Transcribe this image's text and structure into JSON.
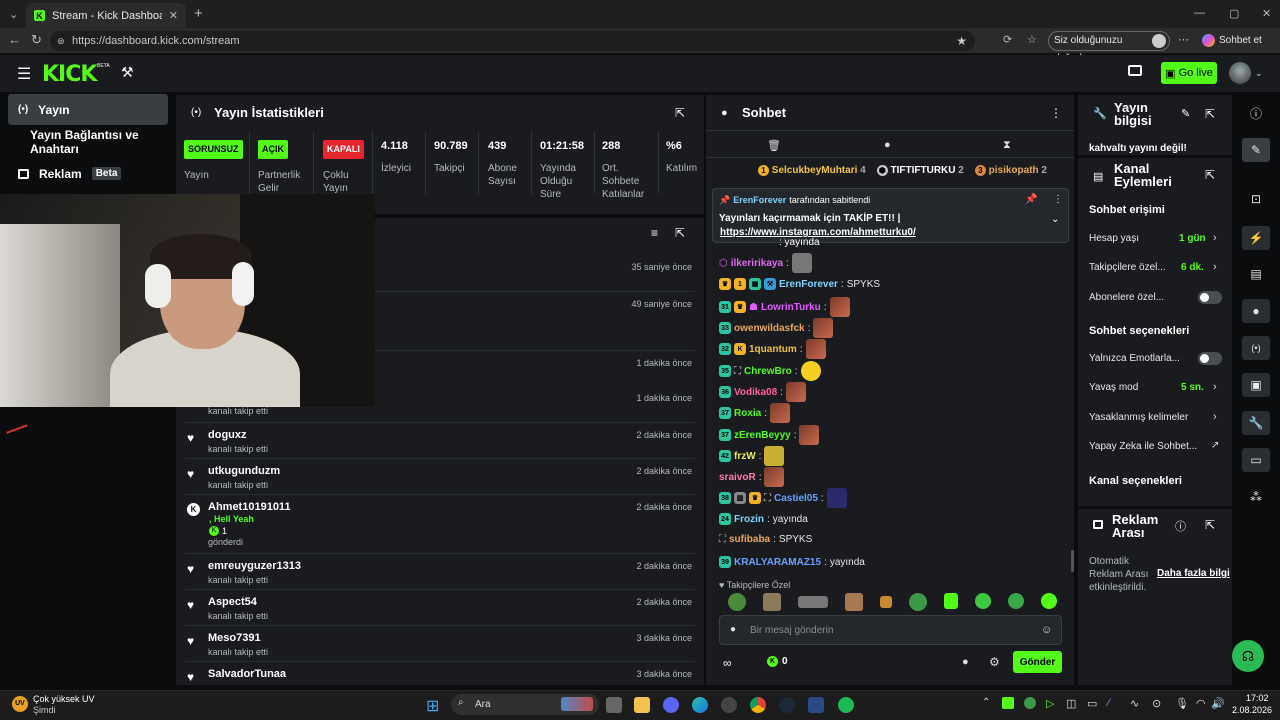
{
  "browser": {
    "tab_title": "Stream - Kick Dashboard",
    "url": "https://dashboard.kick.com/stream",
    "verify_chip": "Siz olduğunuzu doğrulayın",
    "copilot_label": "Sohbet et"
  },
  "topbar": {
    "logo": "KICK",
    "logo_beta": "BETA",
    "go_live": "Go live"
  },
  "leftnav": {
    "items": [
      {
        "label": "Yayın"
      },
      {
        "label": "Yayın Bağlantısı ve Anahtarı"
      },
      {
        "label": "Reklam",
        "badge": "Beta"
      }
    ]
  },
  "stats": {
    "title": "Yayın İstatistikleri",
    "items": [
      {
        "badge": "SORUNSUZ",
        "label": "Yayın",
        "color": "#53fc18"
      },
      {
        "badge": "AÇIK",
        "label": "Partnerlik Gelir",
        "color": "#53fc18"
      },
      {
        "badge": "KAPALI",
        "label": "Çoklu Yayın",
        "color": "#e5262d"
      },
      {
        "value": "4.118",
        "label": "İzleyici"
      },
      {
        "value": "90.789",
        "label": "Takipçi"
      },
      {
        "value": "439",
        "label": "Abone Sayısı"
      },
      {
        "value": "01:21:58",
        "label": "Yayında Olduğu Süre"
      },
      {
        "value": "288",
        "label": "Ort. Sohbete Katılanlar"
      },
      {
        "value": "%6",
        "label": "Katılım"
      }
    ]
  },
  "events": {
    "rows": [
      {
        "name": "",
        "sub": "",
        "time": "35 saniye önce"
      },
      {
        "name": "",
        "sub": "",
        "time": "49 saniye önce"
      },
      {
        "name": "",
        "sub": "",
        "time": "1 dakika önce"
      },
      {
        "name": "",
        "sub": "kanalı takip etti",
        "time": "1 dakika önce"
      },
      {
        "name": "doguxz",
        "sub": "kanalı takip etti",
        "time": "2 dakika önce"
      },
      {
        "name": "utkugunduzm",
        "sub": "kanalı takip etti",
        "time": "2 dakika önce"
      },
      {
        "name": "Ahmet10191011",
        "sub": "gönderdi",
        "message": ", Hell Yeah",
        "amount": "1",
        "time": "2 dakika önce"
      },
      {
        "name": "emreuyguzer1313",
        "sub": "kanalı takip etti",
        "time": "2 dakika önce"
      },
      {
        "name": "Aspect54",
        "sub": "kanalı takip etti",
        "time": "2 dakika önce"
      },
      {
        "name": "Meso7391",
        "sub": "kanalı takip etti",
        "time": "3 dakika önce"
      },
      {
        "name": "SalvadorTunaa",
        "sub": "",
        "time": "3 dakika önce"
      }
    ]
  },
  "chat": {
    "title": "Sohbet",
    "top_gifters": [
      {
        "rank": "1",
        "name": "SelcukbeyMuhtari",
        "count": "4"
      },
      {
        "rank": "",
        "name": "TIFTIFTURKU",
        "count": "2"
      },
      {
        "rank": "3",
        "name": "pisikopath",
        "count": "2"
      }
    ],
    "pinned": {
      "by_user": "ErenForever",
      "by_text": "tarafından sabitlendi",
      "message": "Yayınları kaçırmamak için TAKİP ET!! |",
      "link": "https://www.instagram.com/ahmetturku0/"
    },
    "partial_top": ": yayında",
    "messages": [
      {
        "lvl": "",
        "user": "ilkeririkaya",
        "color": "#e06cf0",
        "text": ""
      },
      {
        "lvl": "",
        "user": "ErenForever",
        "color": "#7fd4ff",
        "text": "SPYKS"
      },
      {
        "lvl": "31",
        "user": "LowrinTurku",
        "color": "#e05cff",
        "text": ""
      },
      {
        "lvl": "33",
        "user": "owenwildasfck",
        "color": "#e8a75a",
        "text": ""
      },
      {
        "lvl": "32",
        "user": "1quantum",
        "color": "#f0c040",
        "text": ""
      },
      {
        "lvl": "35",
        "user": "ChrewBro",
        "color": "#53fc18",
        "text": ""
      },
      {
        "lvl": "36",
        "user": "Vodika08",
        "color": "#ff5fa0",
        "text": ""
      },
      {
        "lvl": "37",
        "user": "Roxia",
        "color": "#53fc18",
        "text": ""
      },
      {
        "lvl": "37",
        "user": "zErenBeyyy",
        "color": "#53fc18",
        "text": ""
      },
      {
        "lvl": "42",
        "user": "frzW",
        "color": "#e8e85a",
        "text": ""
      },
      {
        "lvl": "",
        "user": "sraivoR",
        "color": "#ff7bb0",
        "text": ""
      },
      {
        "lvl": "38",
        "user": "Castiel05",
        "color": "#6aa0ff",
        "text": ""
      },
      {
        "lvl": "24",
        "user": "Frozin",
        "color": "#7fd4ff",
        "text": "yayında"
      },
      {
        "lvl": "",
        "user": "sufibaba",
        "color": "#e8a75a",
        "text": "SPYKS"
      },
      {
        "lvl": "39",
        "user": "KRALYARAMAZ15",
        "color": "#6aa0ff",
        "text": "yayında"
      }
    ],
    "followers_only": "Takipçilere Özel",
    "input_placeholder": "Bir mesaj gönderin",
    "points": "0",
    "send": "Gönder"
  },
  "stream_info": {
    "title": "Yayın bilgisi",
    "text": "kahvaltı yayını değil!"
  },
  "channel_actions": {
    "title": "Kanal Eylemleri",
    "chat_access": "Sohbet erişimi",
    "account_age": {
      "label": "Hesap yaşı",
      "value": "1 gün"
    },
    "followers": {
      "label": "Takipçilere özel...",
      "value": "6 dk."
    },
    "subscribers": {
      "label": "Abonelere özel..."
    },
    "chat_options": "Sohbet seçenekleri",
    "emotes_only": {
      "label": "Yalnızca Emotlarla..."
    },
    "slow_mode": {
      "label": "Yavaş mod",
      "value": "5 sn."
    },
    "banned_words": {
      "label": "Yasaklanmış kelimeler"
    },
    "ai_chat": {
      "label": "Yapay Zeka ile Sohbet..."
    },
    "channel_options": "Kanal seçenekleri"
  },
  "ad_break": {
    "title": "Reklam Arası",
    "text": "Otomatik Reklam Arası etkinleştirildi.",
    "link": "Daha fazla bilgi"
  },
  "taskbar": {
    "weather_title": "Çok yüksek UV",
    "weather_sub": "Şimdi",
    "weather_badge": "UV",
    "search": "Ara",
    "time": "17:02",
    "date": "2.08.2026"
  }
}
